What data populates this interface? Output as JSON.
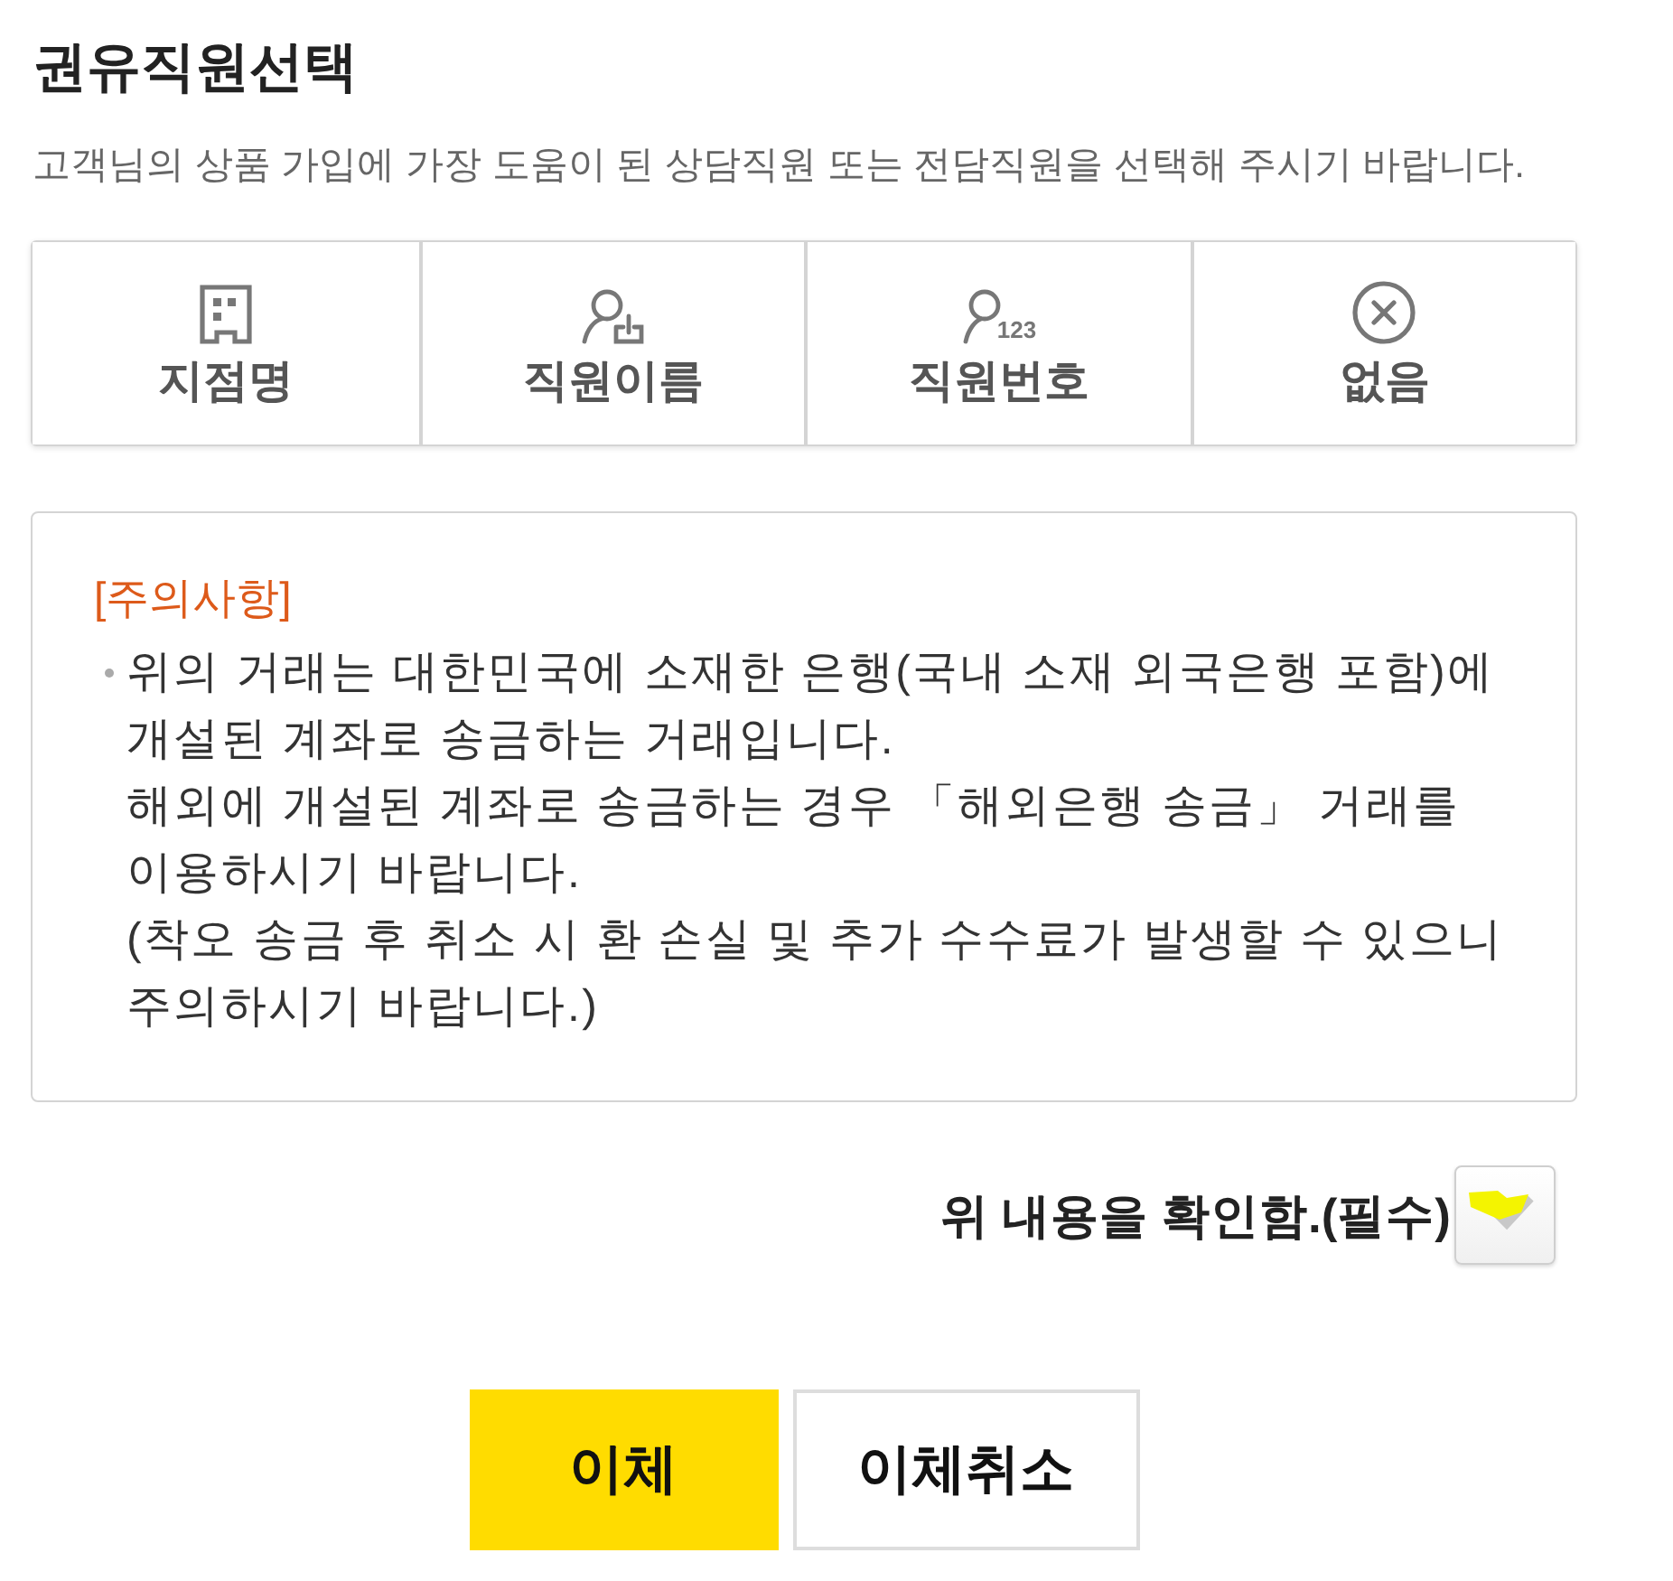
{
  "header": {
    "title": "권유직원선택",
    "description": "고객님의 상품 가입에 가장 도움이 된 상담직원 또는 전담직원을 선택해 주시기 바랍니다."
  },
  "options": [
    {
      "kind": "building",
      "label": "지점명",
      "selected": false
    },
    {
      "kind": "person-box",
      "label": "직원이름",
      "selected": false
    },
    {
      "kind": "person-number",
      "icon_text": "123",
      "label": "직원번호",
      "selected": false
    },
    {
      "kind": "cancel",
      "label": "없음",
      "selected": false
    }
  ],
  "notice": {
    "heading": "[주의사항]",
    "paragraphs": [
      "위의 거래는 대한민국에 소재한 은행(국내 소재 외국은행 포함)에 개설된 계좌로 송금하는 거래입니다.",
      "해외에 개설된 계좌로 송금하는 경우 「해외은행 송금」 거래를 이용하시기 바랍니다.",
      "(착오 송금 후 취소 시 환 손실 및 추가 수수료가 발생할 수 있으니 주의하시기 바랍니다.)"
    ]
  },
  "confirm": {
    "label": "위 내용을 확인함.(필수)",
    "checked": false,
    "highlighted": true
  },
  "buttons": [
    {
      "label": "이체",
      "kind": "primary"
    },
    {
      "label": "이체취소",
      "kind": "secondary"
    }
  ]
}
